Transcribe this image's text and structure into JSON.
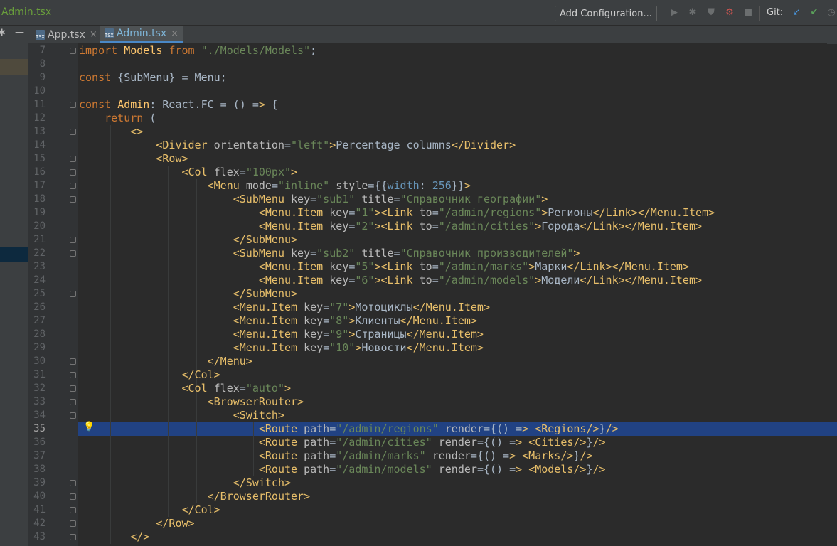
{
  "window": {
    "file_title": "Admin.tsx",
    "run_configuration": "Add Configuration...",
    "git_label": "Git:"
  },
  "tabs": [
    {
      "label": "App.tsx",
      "icon": "tsx-file-icon",
      "file_type": "TSX",
      "active": false
    },
    {
      "label": "Admin.tsx",
      "icon": "tsx-file-icon",
      "file_type": "TSX",
      "active": true
    }
  ],
  "editor": {
    "current_line": 35,
    "colors": {
      "background": "#2b2b2b",
      "gutter": "#313335",
      "current_line": "#214283"
    },
    "lines": [
      {
        "n": 7,
        "text": "import Models from \"./Models/Models\";"
      },
      {
        "n": 8,
        "text": ""
      },
      {
        "n": 9,
        "text": "const {SubMenu} = Menu;"
      },
      {
        "n": 10,
        "text": ""
      },
      {
        "n": 11,
        "text": "const Admin: React.FC = () => {"
      },
      {
        "n": 12,
        "text": "    return ("
      },
      {
        "n": 13,
        "text": "        <>"
      },
      {
        "n": 14,
        "text": "            <Divider orientation=\"left\">Percentage columns</Divider>"
      },
      {
        "n": 15,
        "text": "            <Row>"
      },
      {
        "n": 16,
        "text": "                <Col flex=\"100px\">"
      },
      {
        "n": 17,
        "text": "                    <Menu mode=\"inline\" style={{width: 256}}>"
      },
      {
        "n": 18,
        "text": "                        <SubMenu key=\"sub1\" title=\"Справочник географии\">"
      },
      {
        "n": 19,
        "text": "                            <Menu.Item key=\"1\"><Link to=\"/admin/regions\">Регионы</Link></Menu.Item>"
      },
      {
        "n": 20,
        "text": "                            <Menu.Item key=\"2\"><Link to=\"/admin/cities\">Города</Link></Menu.Item>"
      },
      {
        "n": 21,
        "text": "                        </SubMenu>"
      },
      {
        "n": 22,
        "text": "                        <SubMenu key=\"sub2\" title=\"Справочник производителей\">"
      },
      {
        "n": 23,
        "text": "                            <Menu.Item key=\"5\"><Link to=\"/admin/marks\">Марки</Link></Menu.Item>"
      },
      {
        "n": 24,
        "text": "                            <Menu.Item key=\"6\"><Link to=\"/admin/models\">Модели</Link></Menu.Item>"
      },
      {
        "n": 25,
        "text": "                        </SubMenu>"
      },
      {
        "n": 26,
        "text": "                        <Menu.Item key=\"7\">Мотоциклы</Menu.Item>"
      },
      {
        "n": 27,
        "text": "                        <Menu.Item key=\"8\">Клиенты</Menu.Item>"
      },
      {
        "n": 28,
        "text": "                        <Menu.Item key=\"9\">Страницы</Menu.Item>"
      },
      {
        "n": 29,
        "text": "                        <Menu.Item key=\"10\">Новости</Menu.Item>"
      },
      {
        "n": 30,
        "text": "                    </Menu>"
      },
      {
        "n": 31,
        "text": "                </Col>"
      },
      {
        "n": 32,
        "text": "                <Col flex=\"auto\">"
      },
      {
        "n": 33,
        "text": "                    <BrowserRouter>"
      },
      {
        "n": 34,
        "text": "                        <Switch>"
      },
      {
        "n": 35,
        "text": "                            <Route path=\"/admin/regions\" render={() => <Regions/>}/>"
      },
      {
        "n": 36,
        "text": "                            <Route path=\"/admin/cities\" render={() => <Cities/>}/>"
      },
      {
        "n": 37,
        "text": "                            <Route path=\"/admin/marks\" render={() => <Marks/>}/>"
      },
      {
        "n": 38,
        "text": "                            <Route path=\"/admin/models\" render={() => <Models/>}/>"
      },
      {
        "n": 39,
        "text": "                        </Switch>"
      },
      {
        "n": 40,
        "text": "                    </BrowserRouter>"
      },
      {
        "n": 41,
        "text": "                </Col>"
      },
      {
        "n": 42,
        "text": "            </Row>"
      },
      {
        "n": 43,
        "text": "        </>"
      }
    ]
  }
}
